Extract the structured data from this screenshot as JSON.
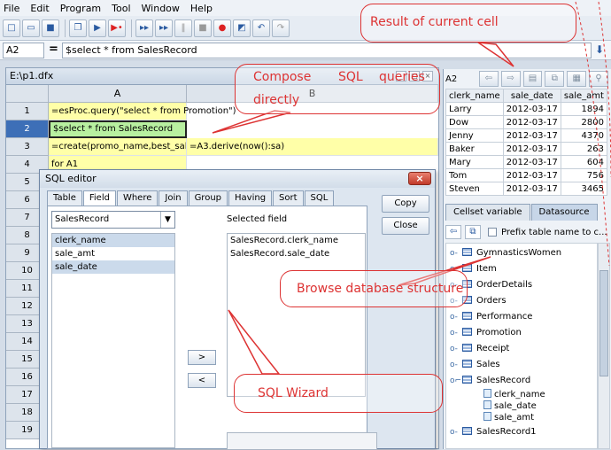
{
  "menu": [
    "File",
    "Edit",
    "Program",
    "Tool",
    "Window",
    "Help"
  ],
  "formula_bar": {
    "cell_ref": "A2",
    "equals": "=",
    "formula": "$select * from SalesRecord"
  },
  "sheet": {
    "title": "E:\\p1.dfx",
    "columns": [
      "A",
      "B"
    ],
    "rows": [
      "1",
      "2",
      "3",
      "4",
      "5",
      "6",
      "7",
      "8",
      "9",
      "10",
      "11",
      "12",
      "13",
      "14",
      "15",
      "16",
      "17",
      "18",
      "19"
    ],
    "cells": {
      "a1": "=esProc.query(\"select * from Promotion\")",
      "a2": "$select * from SalesRecord",
      "a3": "=create(promo_name,best_sale)",
      "b3": "=A3.derive(now():sa)",
      "a4": "for A1"
    }
  },
  "result_panel": {
    "cell_ref": "A2",
    "headers": [
      "clerk_name",
      "sale_date",
      "sale_amt"
    ],
    "rows": [
      [
        "Larry",
        "2012-03-17",
        "1894"
      ],
      [
        "Dow",
        "2012-03-17",
        "2800"
      ],
      [
        "Jenny",
        "2012-03-17",
        "4370"
      ],
      [
        "Baker",
        "2012-03-17",
        "263"
      ],
      [
        "Mary",
        "2012-03-17",
        "604"
      ],
      [
        "Tom",
        "2012-03-17",
        "756"
      ],
      [
        "Steven",
        "2012-03-17",
        "3465"
      ]
    ]
  },
  "datasource": {
    "tabs": [
      "Cellset variable",
      "Datasource"
    ],
    "prefix_label": "Prefix table name to c...",
    "tables": [
      "GymnasticsWomen",
      "Item",
      "OrderDetails",
      "Orders",
      "Performance",
      "Promotion",
      "Receipt",
      "Sales",
      "SalesRecord"
    ],
    "fields": [
      "clerk_name",
      "sale_date",
      "sale_amt"
    ],
    "after": "SalesRecord1"
  },
  "sql_editor": {
    "title": "SQL editor",
    "tabs": [
      "Table",
      "Field",
      "Where",
      "Join",
      "Group",
      "Having",
      "Sort",
      "SQL"
    ],
    "table_select": "SalesRecord",
    "fields": [
      "clerk_name",
      "sale_amt",
      "sale_date"
    ],
    "selected_label": "Selected field",
    "selected": [
      "SalesRecord.clerk_name",
      "SalesRecord.sale_date"
    ],
    "copy": "Copy",
    "close": "Close",
    "add": ">",
    "remove": "<"
  },
  "callouts": {
    "result": "Result of current cell",
    "compose_a": "Compose",
    "compose_b": "SQL",
    "compose_c": "queries",
    "compose_d": "directly",
    "browse": "Browse database structure",
    "wizard": "SQL Wizard"
  },
  "colors": {
    "accent": "#3d6fb7",
    "callout": "#dd3333",
    "yellow_cell": "#ffffa8",
    "green_cell": "#b8f0a0"
  }
}
